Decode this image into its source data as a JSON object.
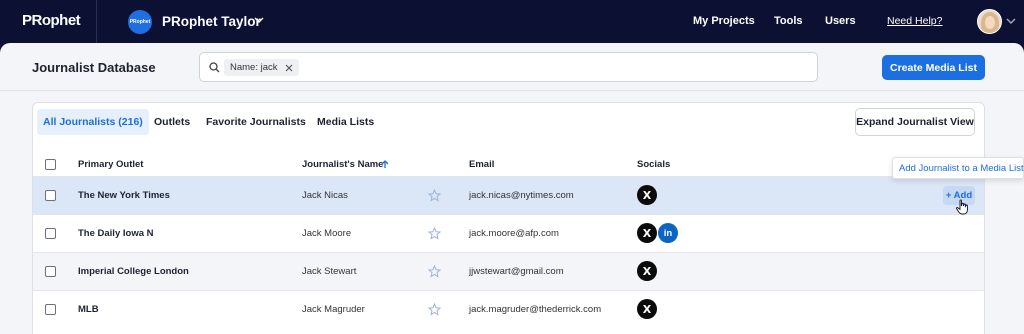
{
  "topbar": {
    "logo": "PRophet",
    "project_avatar_text": "PRophet",
    "project_name": "PRophet Taylor",
    "nav": [
      {
        "label": "My Projects"
      },
      {
        "label": "Tools"
      },
      {
        "label": "Users"
      }
    ],
    "help_link": "Need Help?"
  },
  "header": {
    "title": "Journalist Database",
    "search_chip": "Name: jack",
    "create_button": "Create Media List"
  },
  "tabs": [
    {
      "label": "All Journalists (216)",
      "active": true
    },
    {
      "label": "Outlets"
    },
    {
      "label": "Favorite Journalists"
    },
    {
      "label": "Media Lists"
    }
  ],
  "expand_button": "Expand Journalist View",
  "table": {
    "columns": {
      "outlet": "Primary Outlet",
      "name": "Journalist's Name",
      "email": "Email",
      "socials": "Socials"
    },
    "rows": [
      {
        "outlet": "The New York Times",
        "name": "Jack Nicas",
        "email": "jack.nicas@nytimes.com",
        "socials": [
          "x"
        ],
        "add": "+ Add"
      },
      {
        "outlet": "The Daily Iowa N",
        "name": "Jack Moore",
        "email": "jack.moore@afp.com",
        "socials": [
          "x",
          "linkedin"
        ]
      },
      {
        "outlet": "Imperial College London",
        "name": "Jack Stewart",
        "email": "jjwstewart@gmail.com",
        "socials": [
          "x"
        ]
      },
      {
        "outlet": "MLB",
        "name": "Jack Magruder",
        "email": "jack.magruder@thederrick.com",
        "socials": [
          "x"
        ]
      }
    ]
  },
  "tooltip": "Add Journalist to a Media List",
  "icons": {
    "x": "X",
    "linkedin": "in"
  },
  "colors": {
    "accent": "#1c6fe0",
    "topbar": "#0c1033",
    "highlight_row": "#dbe6f6"
  }
}
